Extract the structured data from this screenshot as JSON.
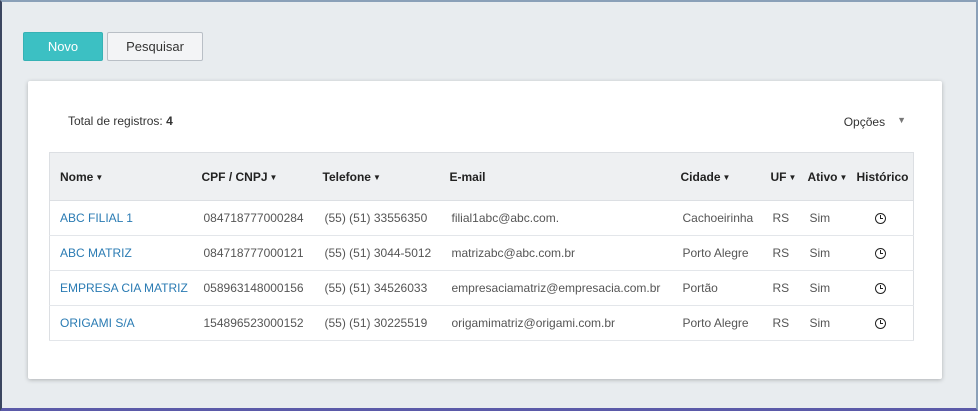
{
  "toolbar": {
    "new_label": "Novo",
    "search_label": "Pesquisar"
  },
  "summary": {
    "total_label": "Total de registros:",
    "total_value": "4"
  },
  "options": {
    "label": "Opções"
  },
  "table": {
    "headers": {
      "nome": "Nome",
      "cpf": "CPF / CNPJ",
      "telefone": "Telefone",
      "email": "E-mail",
      "cidade": "Cidade",
      "uf": "UF",
      "ativo": "Ativo",
      "historico": "Histórico"
    },
    "rows": [
      {
        "nome": "ABC FILIAL 1",
        "cpf": "084718777000284",
        "telefone": "(55) (51) 33556350",
        "email": "filial1abc@abc.com.",
        "cidade": "Cachoeirinha",
        "uf": "RS",
        "ativo": "Sim"
      },
      {
        "nome": "ABC MATRIZ",
        "cpf": "084718777000121",
        "telefone": "(55) (51) 3044-5012",
        "email": "matrizabc@abc.com.br",
        "cidade": "Porto Alegre",
        "uf": "RS",
        "ativo": "Sim"
      },
      {
        "nome": "EMPRESA CIA MATRIZ",
        "cpf": "058963148000156",
        "telefone": "(55) (51) 34526033",
        "email": "empresaciamatriz@empresacia.com.br",
        "cidade": "Portão",
        "uf": "RS",
        "ativo": "Sim"
      },
      {
        "nome": "ORIGAMI S/A",
        "cpf": "154896523000152",
        "telefone": "(55) (51) 30225519",
        "email": "origamimatriz@origami.com.br",
        "cidade": "Porto Alegre",
        "uf": "RS",
        "ativo": "Sim"
      }
    ]
  }
}
